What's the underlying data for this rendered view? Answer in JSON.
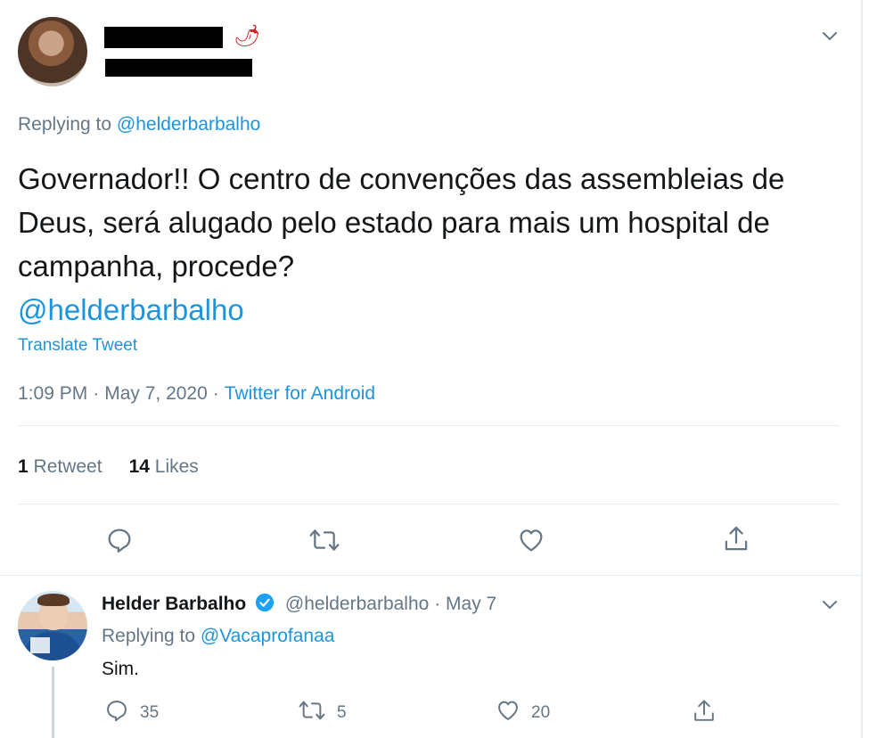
{
  "main_tweet": {
    "emoji": "🌶",
    "replying_prefix": "Replying to",
    "replying_handle": "@helderbarbalho",
    "text": "Governador!! O centro de convenções das assembleias de Deus, será alugado pelo estado para mais um hospital de campanha, procede?",
    "mention": "@helderbarbalho",
    "translate_label": "Translate Tweet",
    "time": "1:09 PM",
    "date": "May 7, 2020",
    "source": "Twitter for Android",
    "retweet_count": "1",
    "retweet_label": "Retweet",
    "like_count": "14",
    "like_label": "Likes",
    "icons": [
      "reply-icon",
      "retweet-icon",
      "like-icon",
      "share-icon",
      "chevron-down-icon"
    ]
  },
  "reply_tweet": {
    "name": "Helder Barbalho",
    "handle": "@helderbarbalho",
    "dot": "·",
    "date": "May 7",
    "replying_prefix": "Replying to",
    "replying_handle": "@Vacaprofanaa",
    "text": "Sim.",
    "reply_count": "35",
    "retweet_count": "5",
    "like_count": "20"
  },
  "colors": {
    "link": "#1b95e0",
    "muted": "#657786",
    "text": "#14171a",
    "border": "#e6ecf0",
    "verified": "#1da1f2"
  }
}
